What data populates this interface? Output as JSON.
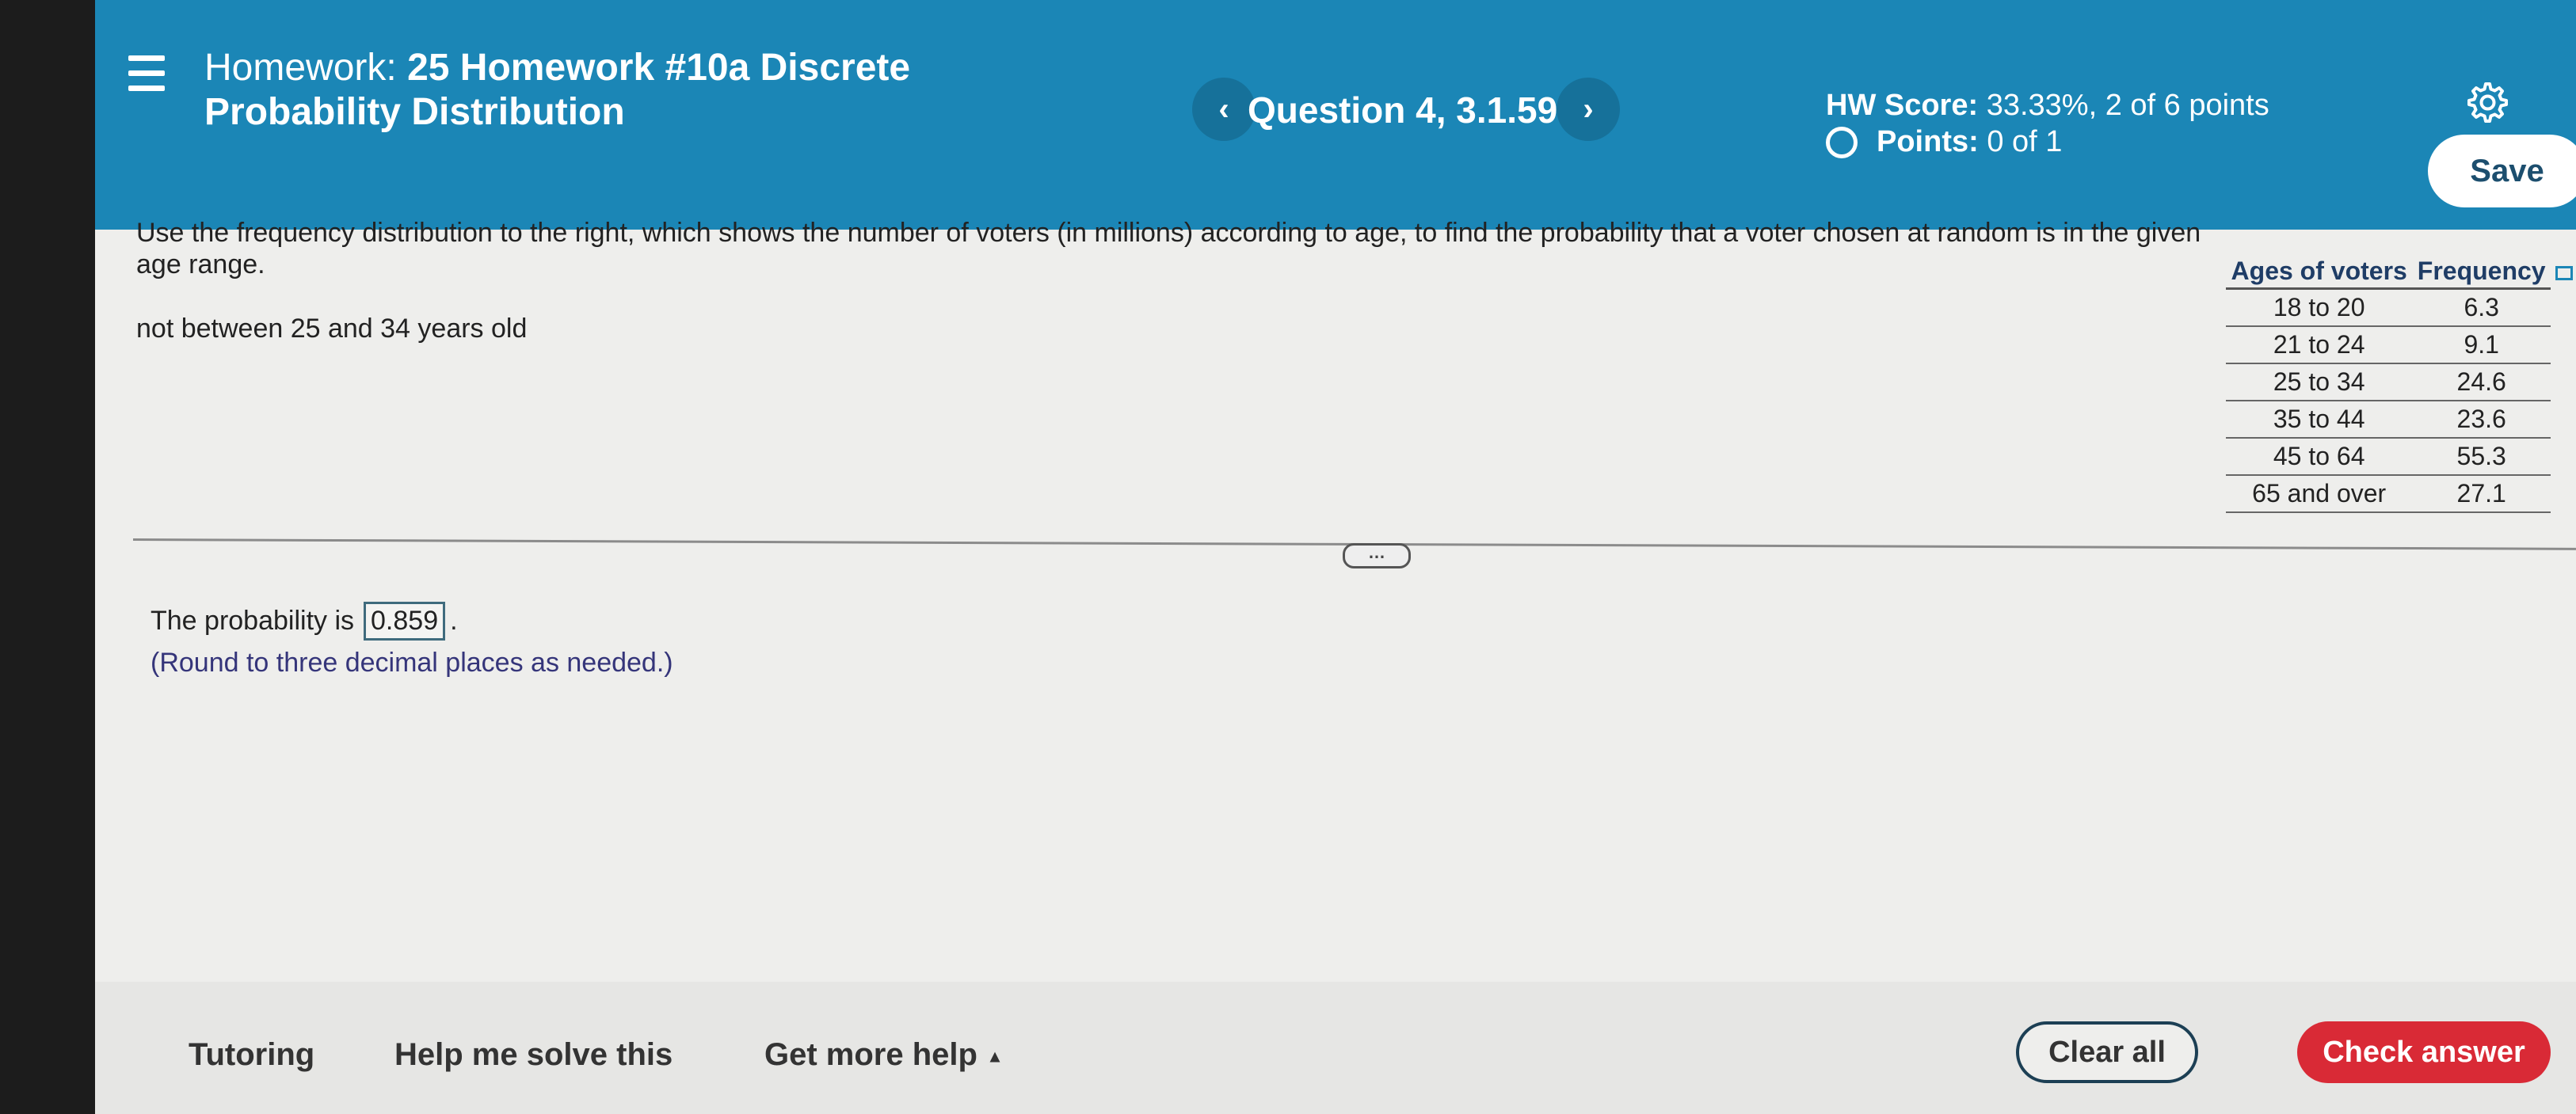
{
  "header": {
    "title_prefix": "Homework:",
    "title_rest": "25 Homework #10a Discrete Probability Distribution",
    "question": "Question 4, 3.1.59",
    "prev_icon": "chevron-left-icon",
    "next_icon": "chevron-right-icon",
    "hw_score_label": "HW Score:",
    "hw_score_value": "33.33%, 2 of 6 points",
    "points_label": "Points:",
    "points_value": "0 of 1",
    "save_label": "Save",
    "accent": "#1b86b6"
  },
  "question": {
    "text": "Use the frequency distribution to the right, which shows the number of voters (in millions) according to age, to find the probability that a voter chosen at random is in the given age range.",
    "condition": "not between 25 and 34 years old"
  },
  "table": {
    "headers": [
      "Ages of voters",
      "Frequency"
    ],
    "rows": [
      [
        "18 to 20",
        "6.3"
      ],
      [
        "21 to 24",
        "9.1"
      ],
      [
        "25 to 34",
        "24.6"
      ],
      [
        "35 to 44",
        "23.6"
      ],
      [
        "45 to 64",
        "55.3"
      ],
      [
        "65 and over",
        "27.1"
      ]
    ]
  },
  "answer": {
    "prefix": "The probability is",
    "value": "0.859",
    "suffix": ".",
    "hint": "(Round to three decimal places as needed.)"
  },
  "footer": {
    "tutoring": "Tutoring",
    "help": "Help me solve this",
    "more_help": "Get more help",
    "clear": "Clear all",
    "check": "Check answer",
    "check_color": "#d92a36"
  }
}
